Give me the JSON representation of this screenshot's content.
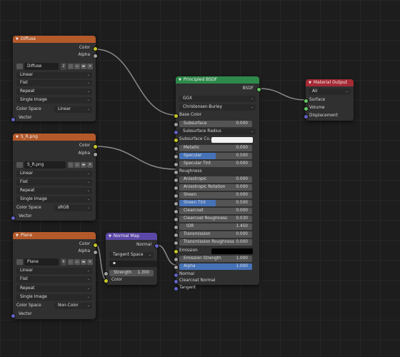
{
  "colors": {
    "shader_header": "#2d8a4a",
    "texture_header": "#b3592a",
    "output_header": "#a62a35",
    "vector_header": "#5c48a8",
    "socket_color": "#c7c729",
    "socket_float": "#a1a1a1",
    "socket_vector": "#6363c7",
    "slider_fill": "#4672b7"
  },
  "diffuse_node": {
    "title": "Diffuse",
    "outputs": [
      "Color",
      "Alpha"
    ],
    "image": {
      "name": "Diffuse",
      "users": "2"
    },
    "interpolation": "Linear",
    "projection": "Flat",
    "extension": "Repeat",
    "source": "Single Image",
    "color_space_label": "Color Space",
    "color_space": "Linear",
    "vector_label": "Vector"
  },
  "srpng_node": {
    "title": "S_R.png",
    "outputs": [
      "Color",
      "Alpha"
    ],
    "image": {
      "name": "S_R.png"
    },
    "interpolation": "Linear",
    "projection": "Flat",
    "extension": "Repeat",
    "source": "Single Image",
    "color_space_label": "Color Space",
    "color_space": "sRGB",
    "vector_label": "Vector"
  },
  "plane_node": {
    "title": "Plane",
    "outputs": [
      "Color",
      "Alpha"
    ],
    "image": {
      "name": "Plane",
      "users": "6"
    },
    "interpolation": "Linear",
    "projection": "Flat",
    "extension": "Repeat",
    "source": "Single Image",
    "color_space_label": "Color Space",
    "color_space": "Non-Color",
    "vector_label": "Vector"
  },
  "normal_map_node": {
    "title": "Normal Map",
    "output": "Normal",
    "space": "Tangent Space",
    "uv_map": "",
    "strength_label": "Strength",
    "strength": "1.300",
    "color_input": "Color"
  },
  "bsdf_node": {
    "title": "Principled BSDF",
    "output": "BSDF",
    "distribution": "GGX",
    "subsurface_method": "Christensen-Burley",
    "base_color": "Base Color",
    "subsurface": {
      "label": "Subsurface",
      "value": "0.000"
    },
    "subsurface_radius": "Subsurface Radius",
    "subsurface_color": "Subsurface Co...",
    "metallic": {
      "label": "Metallic",
      "value": "0.000"
    },
    "specular": {
      "label": "Specular",
      "value": "0.500",
      "fill": 0.5
    },
    "specular_tint": {
      "label": "Specular Tint",
      "value": "0.000"
    },
    "roughness": "Roughness",
    "anisotropic": {
      "label": "Anisotropic",
      "value": "0.000"
    },
    "anisotropic_rotation": {
      "label": "Anisotropic Rotation",
      "value": "0.000"
    },
    "sheen": {
      "label": "Sheen",
      "value": "0.000"
    },
    "sheen_tint": {
      "label": "Sheen Tint",
      "value": "0.500",
      "fill": 0.5
    },
    "clearcoat": {
      "label": "Clearcoat",
      "value": "0.000"
    },
    "clearcoat_roughness": {
      "label": "Clearcoat Roughness",
      "value": "0.030"
    },
    "ior": {
      "label": "IOR",
      "value": "1.450"
    },
    "transmission": {
      "label": "Transmission",
      "value": "0.000"
    },
    "transmission_roughness": {
      "label": "Transmission Roughness",
      "value": "0.000"
    },
    "emission": "Emission",
    "emission_strength": {
      "label": "Emission Strength",
      "value": "1.000"
    },
    "alpha": {
      "label": "Alpha",
      "value": "1.000",
      "fill": 1.0
    },
    "normal": "Normal",
    "clearcoat_normal": "Clearcoat Normal",
    "tangent": "Tangent"
  },
  "output_node": {
    "title": "Material Output",
    "target": "All",
    "inputs": [
      "Surface",
      "Volume",
      "Displacement"
    ]
  }
}
